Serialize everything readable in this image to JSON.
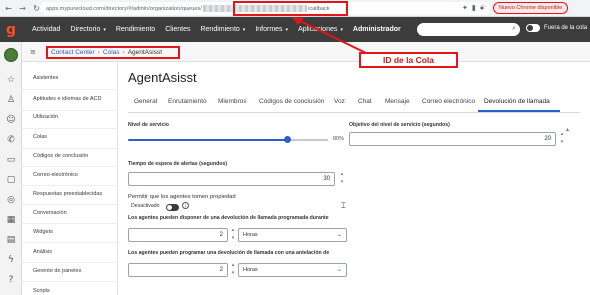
{
  "browser": {
    "url_prefix": "apps.mypurecloud.com/directory/#/admin/organization/queues/",
    "url_suffix": "/callback",
    "update_button": "Nuevo Chrome disponible"
  },
  "topnav": {
    "items": [
      "Actividad",
      "Directorio",
      "Rendimiento",
      "Clientes",
      "Rendimiento",
      "Informes",
      "Aplicaciones",
      "Administrador"
    ],
    "presence_toggle_label": "Fuera de la cola"
  },
  "breadcrumb": [
    "Contact Center",
    "Colas",
    "AgentAsisst"
  ],
  "annotation": {
    "callout": "ID de la Cola",
    "color": "#e0161b"
  },
  "sidemenu": {
    "items": [
      "Asistentes",
      "Aptitudes e idiomas de ACD",
      "Utilización",
      "Colas",
      "Códigos de conclusión",
      "Correo electrónico",
      "Respuestas preestablecidas",
      "Conversación",
      "Widgets",
      "Análisis",
      "Gerente de paneles",
      "Scripts"
    ]
  },
  "page": {
    "title": "AgentAsisst",
    "tabs": [
      "General",
      "Enrutamiento",
      "Miembros",
      "Códigos de conclusión",
      "Voz",
      "Chat",
      "Mensaje",
      "Correo electrónico",
      "Devolución de llamada"
    ],
    "active_tab": "Devolución de llamada"
  },
  "form": {
    "service_level_label": "Nivel de servicio",
    "service_level_value": "80%",
    "service_level_fraction": 0.8,
    "service_goal_label": "Objetivo del nivel de servicio (segundos)",
    "service_goal_value": "20",
    "alert_timeout_label": "Tiempo de espera de alertas (segundos)",
    "alert_timeout_value": "30",
    "allow_agents_label": "Permitir que los agentes tomen propiedad",
    "allow_agents_state": "Desactivado",
    "scheduled_label": "Los agentes pueden disponer de una devolución de llamada programada durante",
    "scheduled_value": "2",
    "scheduled_unit": "Horas",
    "advance_label": "Los agentes pueden programar una devolución de llamada con una antelación de",
    "advance_value": "2",
    "advance_unit": "Horas"
  }
}
